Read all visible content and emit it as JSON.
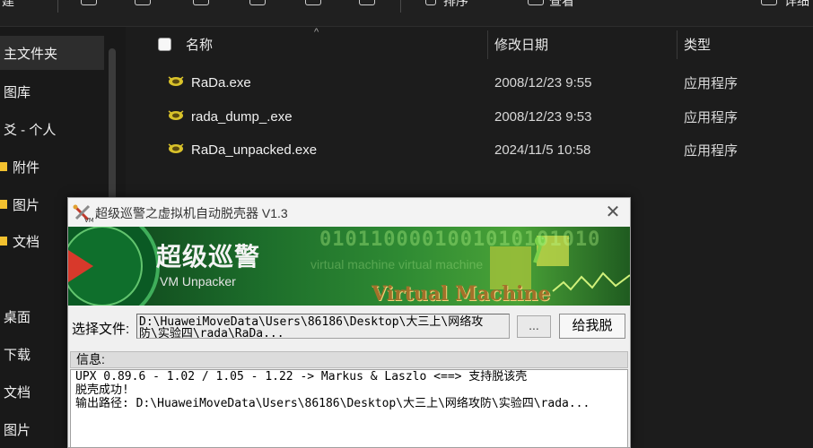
{
  "toolbar": {
    "left_fragment": "建",
    "sort_fragment": "排序",
    "view_fragment": "查看",
    "right_fragment": "详细"
  },
  "nav": {
    "items": [
      {
        "label": "主文件夹",
        "selected": true
      },
      {
        "label": "图库"
      },
      {
        "label": "爻 - 个人"
      },
      {
        "label": "附件",
        "folder": true
      },
      {
        "label": "图片",
        "folder": true
      },
      {
        "label": "文档",
        "folder": true
      },
      {
        "label": "桌面"
      },
      {
        "label": "下载"
      },
      {
        "label": "文档"
      },
      {
        "label": "图片"
      }
    ]
  },
  "list": {
    "columns": {
      "name": "名称",
      "modified": "修改日期",
      "type": "类型"
    },
    "files": [
      {
        "name": "RaDa.exe",
        "modified": "2008/12/23 9:55",
        "type": "应用程序"
      },
      {
        "name": "rada_dump_.exe",
        "modified": "2008/12/23 9:53",
        "type": "应用程序"
      },
      {
        "name": "RaDa_unpacked.exe",
        "modified": "2024/11/5 10:58",
        "type": "应用程序"
      }
    ]
  },
  "dialog": {
    "title": "超级巡警之虚拟机自动脱壳器 V1.3",
    "close_glyph": "✕",
    "banner": {
      "cn_title": "超级巡警",
      "en_title": "VM Unpacker",
      "binary_text": "0101100001001010101010",
      "watermark_text": "virtual machine   virtual machine",
      "vm_text": "Virtual Machine"
    },
    "file_label": "选择文件:",
    "file_value": "D:\\HuaweiMoveData\\Users\\86186\\Desktop\\大三上\\网络攻\n防\\实验四\\rada\\RaDa...",
    "browse_label": "...",
    "go_label": "给我脱",
    "info_label": "信息:",
    "info_lines": "UPX 0.89.6 - 1.02 / 1.05 - 1.22 -> Markus & Laszlo <==> 支持脱该壳\n脱壳成功!\n输出路径: D:\\HuaweiMoveData\\Users\\86186\\Desktop\\大三上\\网络攻防\\实验四\\rada..."
  },
  "colors": {
    "explorer_bg": "#1c1c1c",
    "nav_selected": "#2d2d2d",
    "dialog_bg": "#f0f0f0",
    "banner_green": "#2f8b33",
    "folder_yellow": "#f3c12f"
  }
}
